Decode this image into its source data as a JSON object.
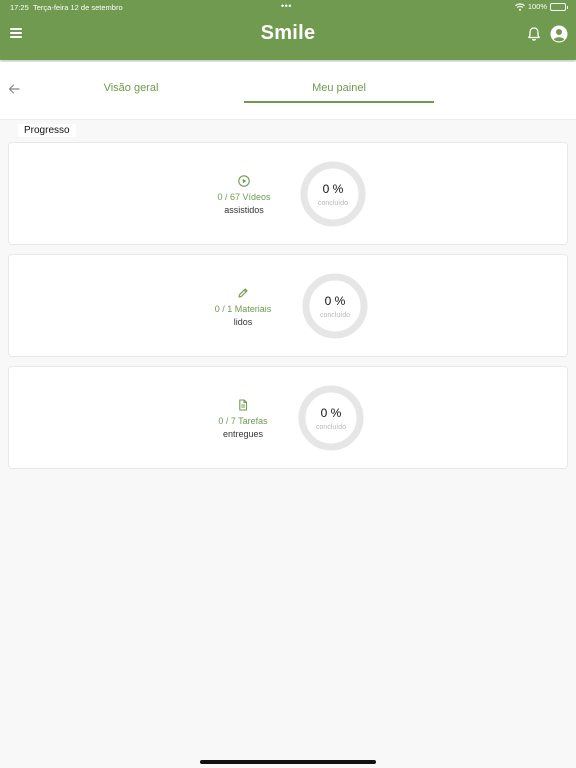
{
  "status_bar": {
    "time": "17:25",
    "date": "Terça-feira 12 de setembro",
    "dots": "•••",
    "battery": "100%"
  },
  "header": {
    "title": "Smile",
    "icons": [
      "menu-icon",
      "bell-icon",
      "account-icon"
    ]
  },
  "tabs": [
    {
      "label": "Visão geral",
      "active": false
    },
    {
      "label": "Meu painel",
      "active": true
    }
  ],
  "section": {
    "title": "Progresso"
  },
  "progress_cards": [
    {
      "icon": "play-circle-icon",
      "count": "0 / 67 Vídeos",
      "label": "assistidos",
      "percent_text": "0 %",
      "percent_value": 0,
      "sublabel": "concluído"
    },
    {
      "icon": "pencil-icon",
      "count": "0 / 1 Materiais",
      "label": "lidos",
      "percent_text": "0 %",
      "percent_value": 0,
      "sublabel": "concluído"
    },
    {
      "icon": "document-icon",
      "count": "0 / 7 Tarefas",
      "label": "entregues",
      "percent_text": "0 %",
      "percent_value": 0,
      "sublabel": "concluído"
    }
  ],
  "colors": {
    "brand": "#6f9a4f",
    "ring_track": "#e6e6e6"
  }
}
